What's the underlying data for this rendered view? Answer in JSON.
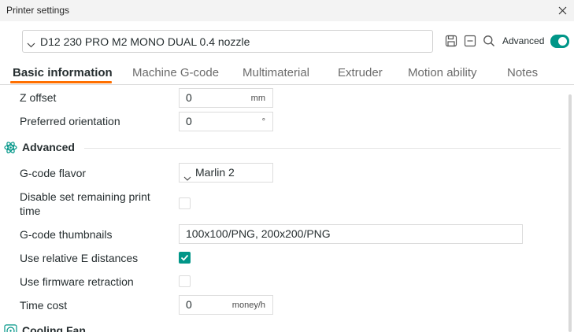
{
  "window": {
    "title": "Printer settings"
  },
  "preset": {
    "value": "D12 230 PRO M2 MONO DUAL 0.4 nozzle"
  },
  "toolbar": {
    "advanced_label": "Advanced",
    "advanced_on": true
  },
  "tabs": [
    {
      "label": "Basic information",
      "active": true
    },
    {
      "label": "Machine G-code"
    },
    {
      "label": "Multimaterial"
    },
    {
      "label": "Extruder"
    },
    {
      "label": "Motion ability"
    },
    {
      "label": "Notes"
    }
  ],
  "settings": {
    "z_offset": {
      "label": "Z offset",
      "value": "0",
      "unit": "mm"
    },
    "preferred_orientation": {
      "label": "Preferred orientation",
      "value": "0",
      "unit": "°"
    },
    "advanced_section": {
      "title": "Advanced"
    },
    "gcode_flavor": {
      "label": "G-code flavor",
      "value": "Marlin 2"
    },
    "disable_remaining": {
      "label_line1": "Disable set remaining print",
      "label_line2": "time",
      "checked": false
    },
    "gcode_thumbnails": {
      "label": "G-code thumbnails",
      "value": "100x100/PNG, 200x200/PNG"
    },
    "relative_e": {
      "label": "Use relative E distances",
      "checked": true
    },
    "firmware_retraction": {
      "label": "Use firmware retraction",
      "checked": false
    },
    "time_cost": {
      "label": "Time cost",
      "value": "0",
      "unit": "money/h"
    },
    "cooling_section": {
      "title": "Cooling Fan"
    }
  },
  "colors": {
    "accent": "#009688",
    "tab_underline": "#ff6f00"
  }
}
